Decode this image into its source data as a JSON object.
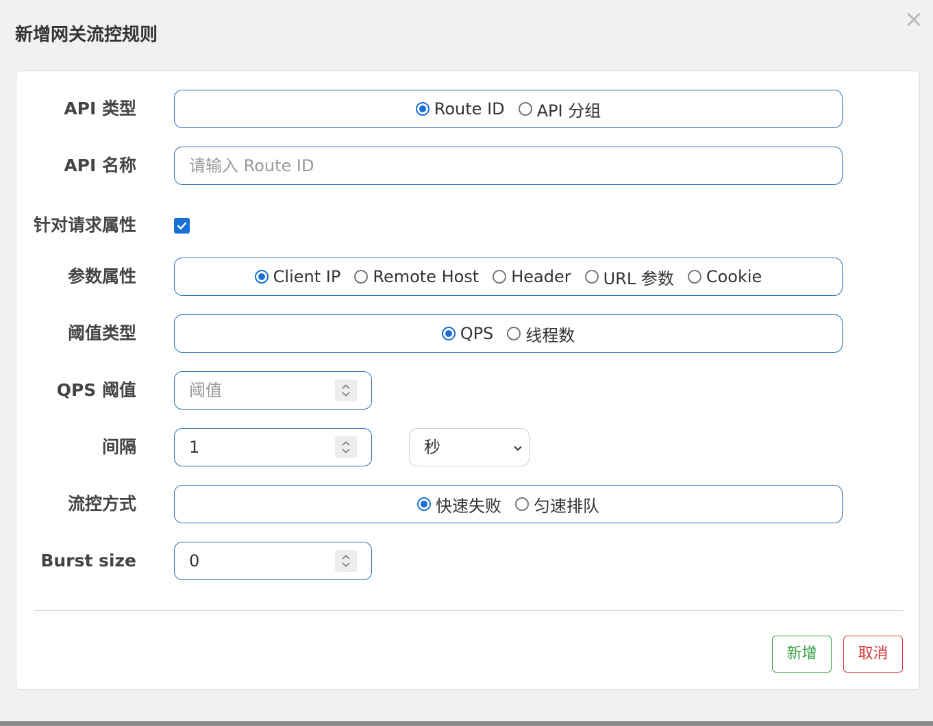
{
  "dialog": {
    "title": "新增网关流控规则",
    "close_icon": "×"
  },
  "form": {
    "api_type": {
      "label": "API 类型",
      "options": [
        "Route ID",
        "API 分组"
      ],
      "selected": "Route ID"
    },
    "api_name": {
      "label": "API 名称",
      "placeholder": "请输入 Route ID",
      "value": ""
    },
    "request_attr": {
      "label": "针对请求属性",
      "checked": true
    },
    "param_attr": {
      "label": "参数属性",
      "options": [
        "Client IP",
        "Remote Host",
        "Header",
        "URL 参数",
        "Cookie"
      ],
      "selected": "Client IP"
    },
    "threshold_type": {
      "label": "阈值类型",
      "options": [
        "QPS",
        "线程数"
      ],
      "selected": "QPS"
    },
    "qps_threshold": {
      "label": "QPS 阈值",
      "placeholder": "阈值",
      "value": ""
    },
    "interval": {
      "label": "间隔",
      "value": "1",
      "unit": "秒"
    },
    "control_mode": {
      "label": "流控方式",
      "options": [
        "快速失败",
        "匀速排队"
      ],
      "selected": "快速失败"
    },
    "burst_size": {
      "label": "Burst size",
      "value": "0"
    }
  },
  "buttons": {
    "add": "新增",
    "cancel": "取消"
  },
  "colors": {
    "accent": "#1a6fd6",
    "field_border": "#2f6fb6",
    "add_button": "#3aa04a",
    "cancel_button": "#d9373a"
  }
}
